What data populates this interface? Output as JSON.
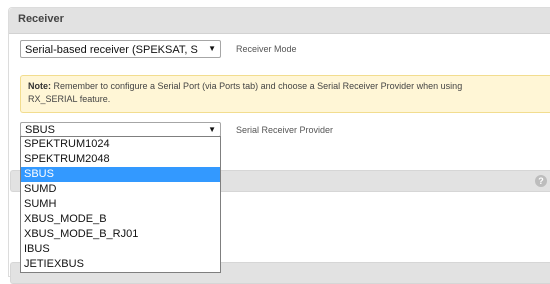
{
  "panel": {
    "title": "Receiver"
  },
  "receiver_mode": {
    "value": "Serial-based receiver (SPEKSAT, S",
    "label": "Receiver Mode"
  },
  "note": {
    "prefix": "Note:",
    "line1": " Remember to configure a Serial Port (via Ports tab) and choose a Serial Receiver Provider when using",
    "line2": "RX_SERIAL feature."
  },
  "serial_provider": {
    "value": "SBUS",
    "label": "Serial Receiver Provider",
    "options": [
      "SPEKTRUM1024",
      "SPEKTRUM2048",
      "SBUS",
      "SUMD",
      "SUMH",
      "XBUS_MODE_B",
      "XBUS_MODE_B_RJ01",
      "IBUS",
      "JETIEXBUS"
    ],
    "selected_index": 2
  },
  "icons": {
    "help": "help-icon"
  },
  "colors": {
    "highlight": "#3399ff",
    "note_bg": "#fff6d6",
    "header_bg": "#e2e2e2"
  }
}
